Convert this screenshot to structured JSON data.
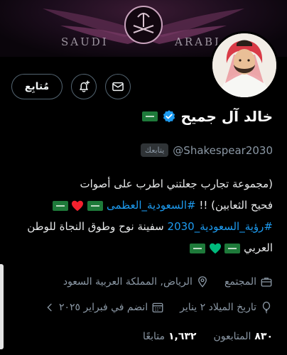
{
  "banner": {
    "left_text": "SAUDI",
    "right_text": "ARABI"
  },
  "profile": {
    "display_name": "خالد آل جميح",
    "handle": "@Shakespear2030",
    "follows_you": "يتابعك",
    "verified": true
  },
  "actions": {
    "follow_label": "مُتابِع"
  },
  "bio": {
    "line1": "(مجموعة تجارب جعلتني اطرب على أصوات",
    "line2_text": "فحيح الثعابين) !! ",
    "line2_hashtag": "#السعودية_العظمى",
    "line3_hashtag": "#رؤية_السعودية_2030",
    "line3_text": " سفينة نوح وطوق النجاة للوطن",
    "line4_text": "العربي"
  },
  "meta": {
    "category": "المجتمع",
    "location": "الرياض, المملكة العربية السعود",
    "birth_date": "تاريخ الميلاد ٢ يناير",
    "joined": "انضم في فبراير ٢٠٢٥"
  },
  "stats": {
    "following_count": "١,٦٣٢",
    "following_label": "متابعًا",
    "followers_count": "٨٣٠",
    "followers_label": "المتابعون"
  },
  "colors": {
    "accent": "#1d9bf0",
    "flag_green": "#1e7a3a",
    "heart_red": "#f4212e",
    "heart_green": "#00ba7c"
  }
}
